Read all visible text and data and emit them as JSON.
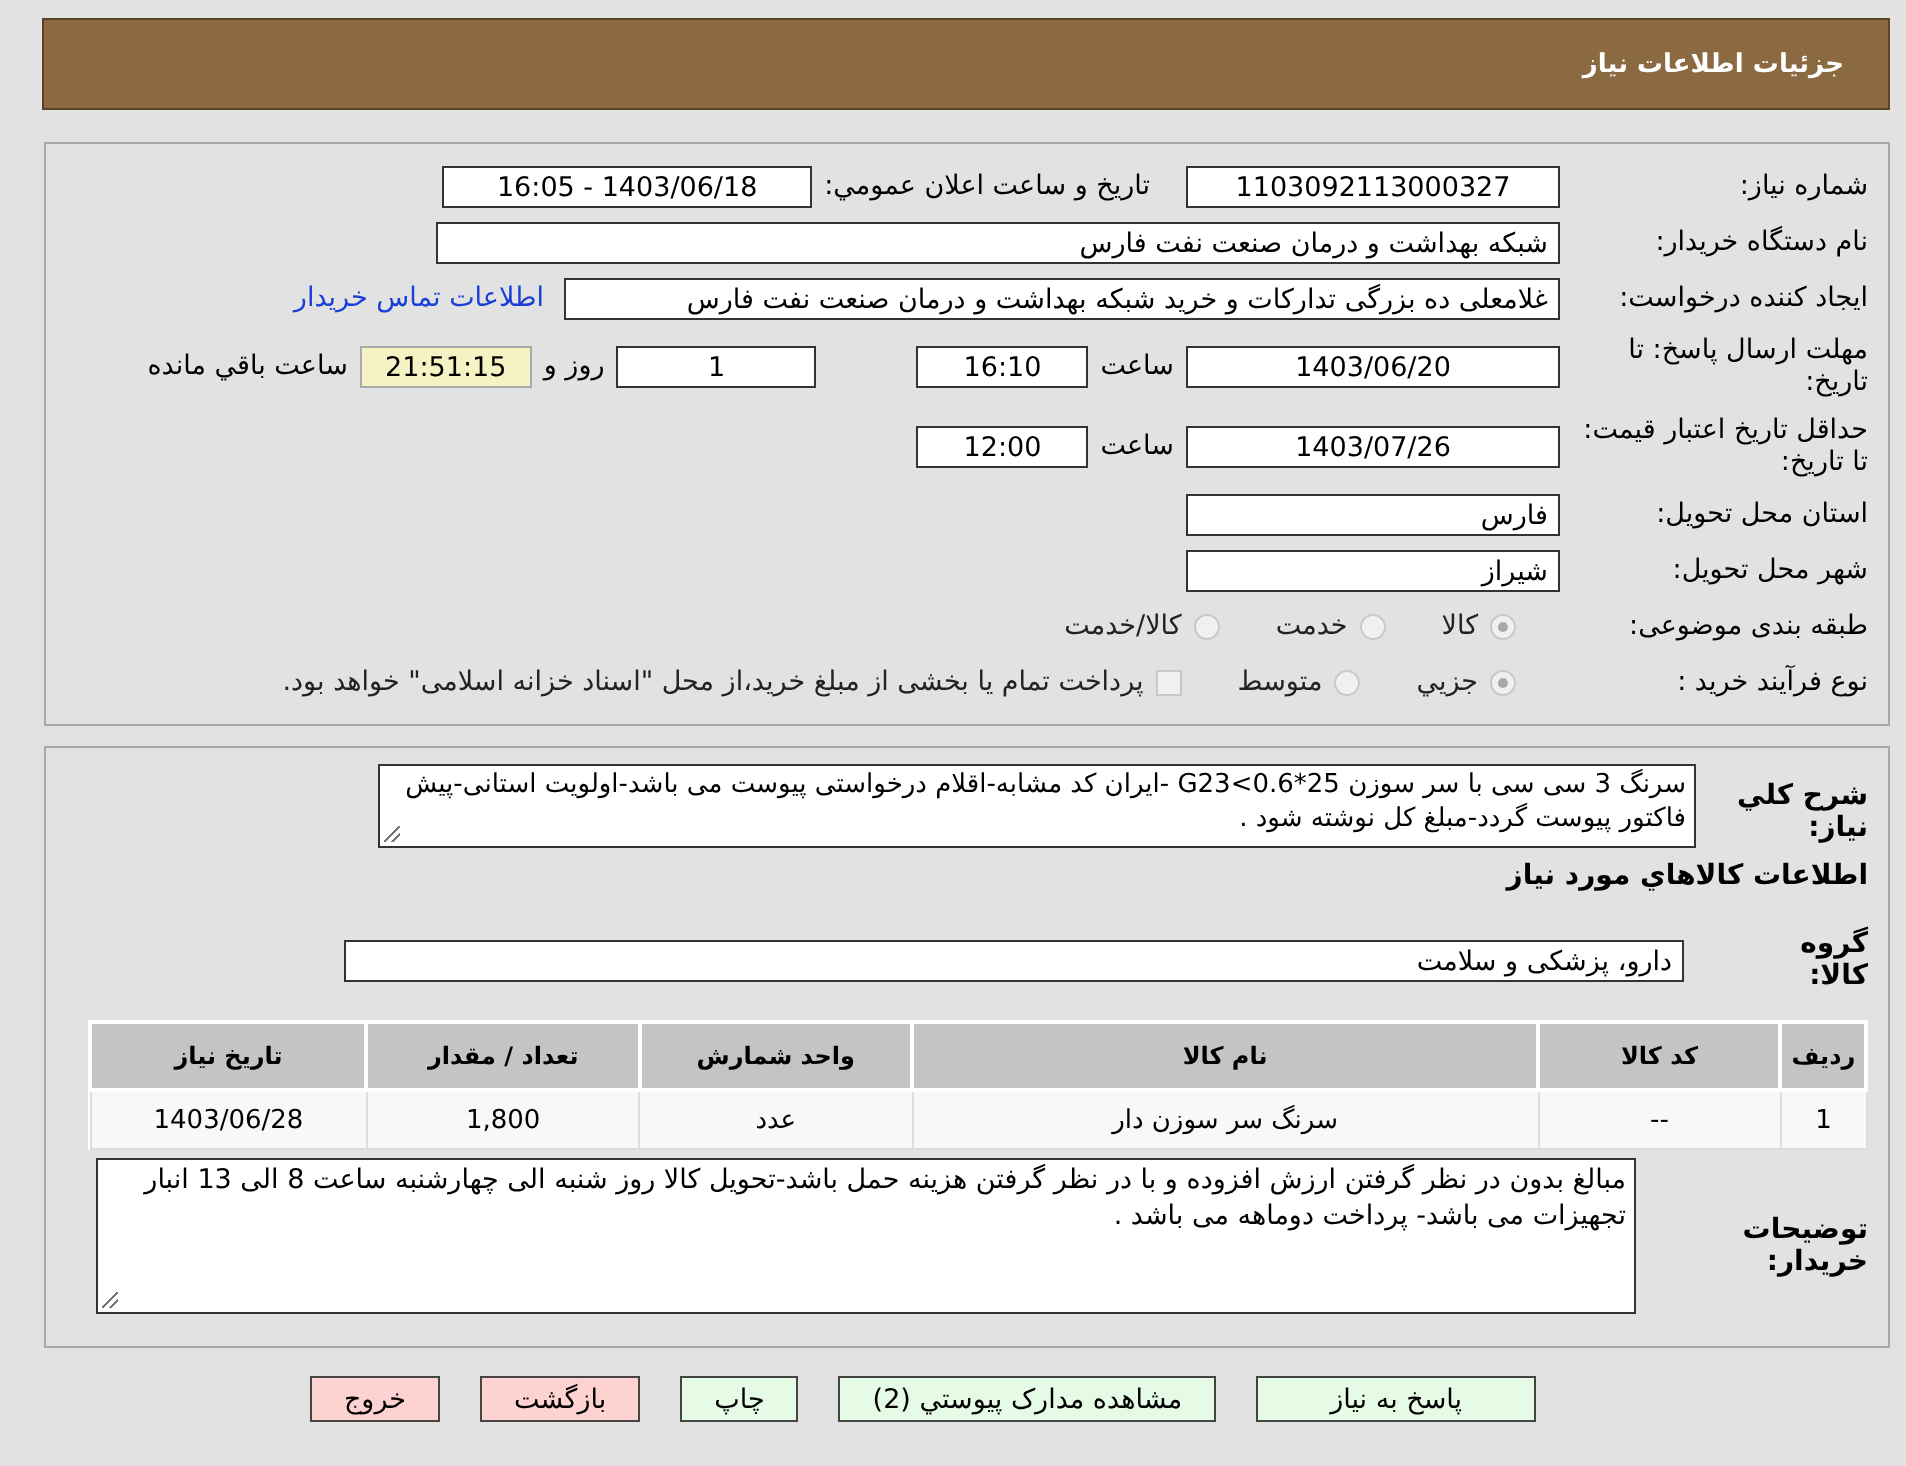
{
  "header": {
    "title": "جزئیات اطلاعات نیاز"
  },
  "form": {
    "need_number": {
      "label": "شماره نیاز:",
      "value": "1103092113000327"
    },
    "announce": {
      "label": "تاریخ و ساعت اعلان عمومي:",
      "value": "1403/06/18 - 16:05"
    },
    "buyer": {
      "label": "نام دستگاه خریدار:",
      "value": "شبکه بهداشت و درمان صنعت نفت فارس"
    },
    "creator": {
      "label": "ایجاد کننده درخواست:",
      "value": "غلامعلی ده بزرگی تدارکات و خرید شبکه بهداشت و درمان صنعت نفت فارس",
      "link": "اطلاعات تماس خریدار"
    },
    "deadline": {
      "label": "مهلت ارسال پاسخ: تا تاریخ:",
      "date": "1403/06/20",
      "time_label": "ساعت",
      "time": "16:10",
      "days": "1",
      "days_label": "روز و",
      "remaining": "21:51:15",
      "remaining_label": "ساعت باقي مانده"
    },
    "validity": {
      "label": "حداقل تاریخ اعتبار قیمت: تا تاریخ:",
      "date": "1403/07/26",
      "time_label": "ساعت",
      "time": "12:00"
    },
    "province": {
      "label": "استان محل تحویل:",
      "value": "فارس"
    },
    "city": {
      "label": "شهر محل تحویل:",
      "value": "شیراز"
    },
    "category": {
      "label": "طبقه بندی موضوعی:",
      "options": [
        {
          "label": "کالا",
          "selected": true
        },
        {
          "label": "خدمت",
          "selected": false
        },
        {
          "label": "کالا/خدمت",
          "selected": false
        }
      ]
    },
    "process": {
      "label": "نوع فرآیند خرید :",
      "options": [
        {
          "label": "جزیي",
          "selected": true
        },
        {
          "label": "متوسط",
          "selected": false
        }
      ],
      "payment": {
        "label": "پرداخت تمام یا بخشی از مبلغ خرید،از محل \"اسناد خزانه اسلامی\" خواهد بود.",
        "checked": false
      }
    }
  },
  "details": {
    "description": {
      "label": "شرح کلي نیاز:",
      "value": "سرنگ 3 سی سی با سر سوزن 25*G23<0.6  -ایران کد مشابه-اقلام درخواستی پیوست می باشد-اولویت استانی-پیش فاکتور پیوست گردد-مبلغ کل نوشته شود ."
    },
    "items_title": "اطلاعات کالاهاي مورد نیاز",
    "group": {
      "label": "گروه کالا:",
      "value": "دارو، پزشکی و سلامت"
    },
    "table": {
      "columns": [
        "ردیف",
        "کد کالا",
        "نام کالا",
        "واحد شمارش",
        "تعداد / مقدار",
        "تاریخ نیاز"
      ],
      "rows": [
        [
          "1",
          "--",
          "سرنگ سر سوزن دار",
          "عدد",
          "1,800",
          "1403/06/28"
        ]
      ]
    },
    "notes": {
      "label": "توضیحات خریدار:",
      "value": "مبالغ بدون در نظر گرفتن ارزش افزوده و با در نظر گرفتن هزینه حمل باشد-تحویل کالا روز شنبه الی چهارشنبه ساعت 8 الی 13 انبار تجهیزات می باشد- پرداخت دوماهه می باشد ."
    }
  },
  "buttons": [
    {
      "label": "پاسخ به نیاز",
      "kind": "primary"
    },
    {
      "label": "مشاهده مدارک پیوستي (2)",
      "kind": "primary"
    },
    {
      "label": "چاپ",
      "kind": "primary"
    },
    {
      "label": "بازگشت",
      "kind": "danger"
    },
    {
      "label": "خروج",
      "kind": "danger"
    }
  ]
}
